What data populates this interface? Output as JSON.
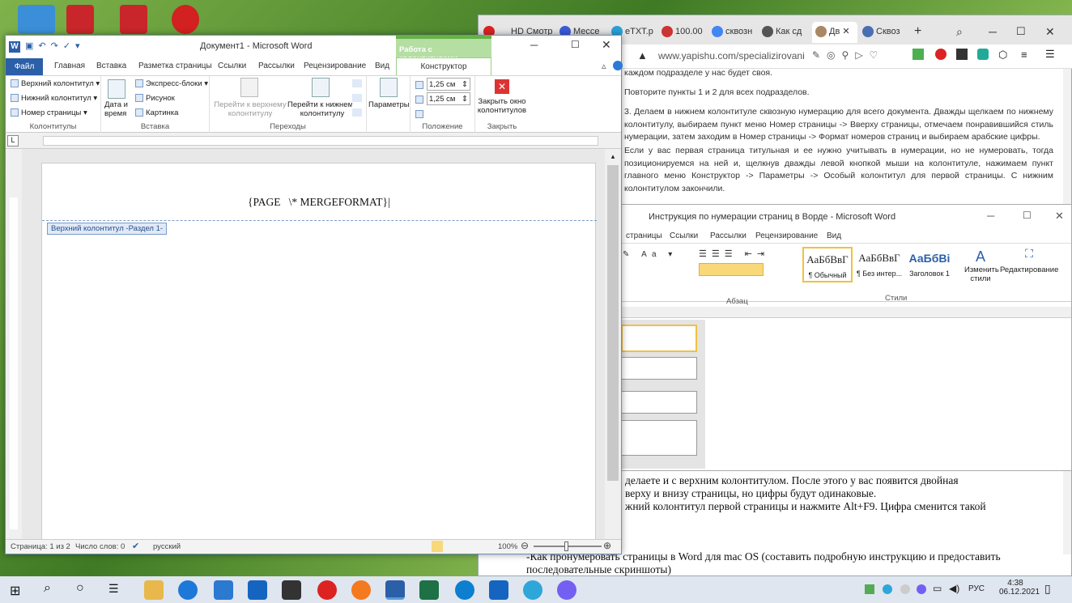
{
  "browser": {
    "tabs": [
      "HD Смотр",
      "Мессе",
      "eTXT.p",
      "100.00",
      "сквозн",
      "Как сд",
      "Дв",
      "Сквоз"
    ],
    "url": "www.yapishu.com/specializirovani",
    "paragraphs": [
      "каждом подразделе у нас будет своя.",
      "Повторите пункты 1 и 2 для всех подразделов.",
      "3. Делаем в нижнем колонтитуле сквозную нумерацию для всего документа. Дважды щелкаем по нижнему колонтитулу, выбираем пункт меню Номер страницы -> Вверху страницы, отмечаем понравившийся стиль нумерации, затем заходим в Номер страницы -> Формат номеров страниц и выбираем арабские цифры.",
      "Если у вас первая страница титульная и ее нужно учитывать в нумерации, но не нумеровать, тогда позиционируемся на ней и, щелкнув дважды левой кнопкой мыши на колонтитуле, нажимаем пункт главного меню Конструктор -> Параметры -> Особый колонтитул для первой страницы. С нижним колонтитулом закончили."
    ]
  },
  "word2": {
    "title": "Инструкция по нумерации страниц в Ворде - Microsoft Word",
    "tabs": [
      "страницы",
      "Ссылки",
      "Рассылки",
      "Рецензирование",
      "Вид"
    ],
    "styles": [
      {
        "preview": "АаБбВвГ",
        "name": "¶ Обычный"
      },
      {
        "preview": "АаБбВвГ",
        "name": "¶ Без интер..."
      },
      {
        "preview": "АаБбВі",
        "name": "Заголовок 1"
      }
    ],
    "change_styles": "Изменить стили",
    "editing": "Редактирование",
    "group_para": "Абзац",
    "group_styles": "Стили"
  },
  "doc_lines": [
    "делаете и с верхним колонтитулом. После этого у вас появится двойная",
    "верху и внизу страницы, но цифры будут одинаковые.",
    "жний колонтитул первой страницы и нажмите Alt+F9. Цифра сменится такой",
    "-Как пронумеровать страницы в Word для mac OS (составить подробную инструкцию и предоставить",
    "последовательные скриншоты)"
  ],
  "word1": {
    "title": "Документ1 - Microsoft Word",
    "context_tab": "Работа с колонтитулами",
    "tabs": [
      "Файл",
      "Главная",
      "Вставка",
      "Разметка страницы",
      "Ссылки",
      "Рассылки",
      "Рецензирование",
      "Вид",
      "Конструктор"
    ],
    "ribbon": {
      "header": "Верхний колонтитул",
      "footer": "Нижний колонтитул",
      "page_number": "Номер страницы",
      "group_hf": "Колонтитулы",
      "date_time": "Дата и время",
      "quick_parts": "Экспресс-блоки",
      "picture": "Рисунок",
      "clipart": "Картинка",
      "group_insert": "Вставка",
      "goto_header": "Перейти к верхнему колонтитулу",
      "goto_footer": "Перейти к нижнему колонтитулу",
      "group_nav": "Переходы",
      "options": "Параметры",
      "top_val": "1,25 см",
      "bottom_val": "1,25 см",
      "group_pos": "Положение",
      "close": "Закрыть окно колонтитулов",
      "group_close": "Закрыть"
    },
    "field_code": "{PAGE   \\* MERGEFORMAT}",
    "header_tag": "Верхний колонтитул -Раздел 1-",
    "status": {
      "page": "Страница: 1 из 2",
      "words": "Число слов: 0",
      "lang": "русский",
      "zoom": "100%"
    }
  },
  "taskbar": {
    "lang": "РУС",
    "time": "4:38",
    "date": "06.12.2021"
  }
}
